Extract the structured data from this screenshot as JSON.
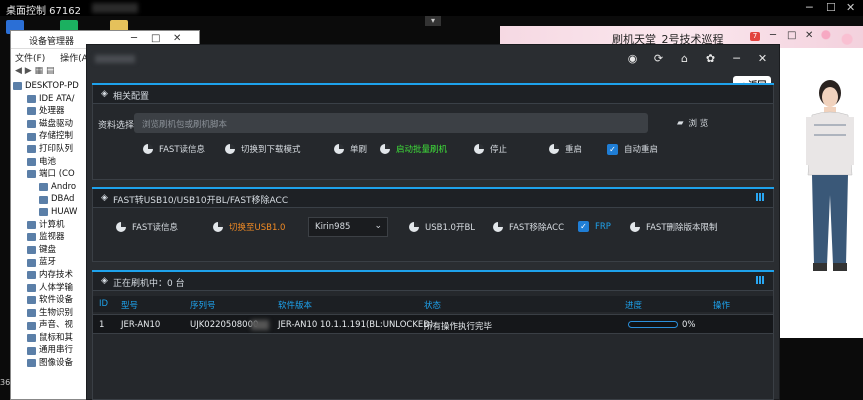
{
  "remote": {
    "title": "桌面控制 67162",
    "min": "─",
    "max": "☐",
    "close": "✕",
    "dropdown": "▾"
  },
  "devmgr": {
    "title": "设备管理器",
    "menu": [
      "文件(F)",
      "操作(A)"
    ],
    "nodes": [
      "DESKTOP-PD",
      "IDE ATA/",
      "处理器",
      "磁盘驱动",
      "存储控制",
      "打印队列",
      "电池",
      "端口 (CO",
      "Andro",
      "DBAd",
      "HUAW",
      "计算机",
      "监视器",
      "键盘",
      "蓝牙",
      "内存技术",
      "人体学输",
      "软件设备",
      "生物识别",
      "声音、视",
      "鼠标和其",
      "通用串行",
      "图像设备"
    ]
  },
  "left_status": "36",
  "pink": {
    "title": "刷机天堂_2号技术巡程",
    "badge": "7",
    "ctl_min": "─",
    "ctl_max": "□",
    "ctl_close": "✕"
  },
  "tool": {
    "titlebar_icons": [
      "globe-icon",
      "refresh-icon",
      "home-icon",
      "gear-icon",
      "minimize-icon",
      "close-icon"
    ],
    "titlebar_glyphs": [
      "◉",
      "⟳",
      "⌂",
      "✿",
      "─",
      "✕"
    ],
    "back_label": "< 返回",
    "section1": {
      "title": "相关配置",
      "file_label": "资料选择",
      "file_placeholder": "浏览刷机包或刷机脚本",
      "browse_label": "浏 览",
      "options": [
        {
          "label": "FAST读信息",
          "color": "#d8dde2"
        },
        {
          "label": "切换到下载模式",
          "color": "#d8dde2"
        },
        {
          "label": "单刷",
          "color": "#d8dde2"
        },
        {
          "label": "启动批量刷机",
          "color": "#3fe03a"
        },
        {
          "label": "停止",
          "color": "#d8dde2"
        },
        {
          "label": "重启",
          "color": "#d8dde2"
        }
      ],
      "auto_reboot": "自动重启"
    },
    "section2": {
      "title": "FAST转USB10/USB10开BL/FAST移除ACC",
      "fast_read": "FAST读信息",
      "switch_usb": "切换至USB1.0",
      "chip": "Kirin985",
      "usb_unlock": "USB1.0开BL",
      "remove_acc": "FAST移除ACC",
      "frp": "FRP",
      "remove_limit": "FAST删除版本限制"
    },
    "section3": {
      "title": "正在刷机中：0 台",
      "columns": [
        "ID",
        "型号",
        "序列号",
        "软件版本",
        "状态",
        "进度",
        "操作"
      ],
      "rows": [
        {
          "id": "1",
          "model": "JER-AN10",
          "serial": "UJK0220508000",
          "version": "JER-AN10 10.1.1.191(BL:UNLOCKED)",
          "status": "所有操作执行完毕",
          "progress_pct": 0,
          "progress": "0%"
        }
      ]
    }
  }
}
